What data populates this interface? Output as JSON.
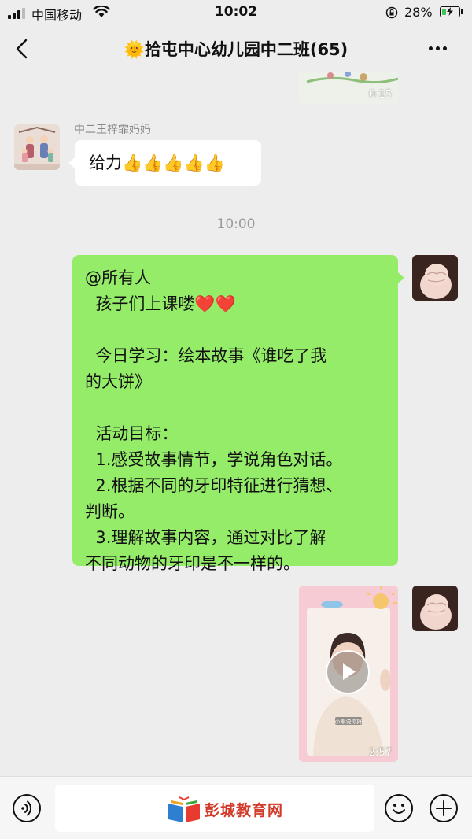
{
  "status_bar": {
    "carrier": "中国移动",
    "time": "10:02",
    "battery_percent": "28%",
    "battery_level": 0.28,
    "battery_color": "#43c15a"
  },
  "nav": {
    "title": "🌞拾屯中心幼儿园中二班(65)",
    "back_icon": "chevron-left-icon",
    "more_icon": "more-dots-icon"
  },
  "messages": {
    "top_video": {
      "duration": "0:15"
    },
    "msg1": {
      "sender": "中二王梓霏妈妈",
      "text": "给力👍👍👍👍👍"
    },
    "timestamp": "10:00",
    "msg2": {
      "lines": [
        "@所有人",
        "  孩子们上课喽❤️❤️",
        "",
        "  今日学习：绘本故事《谁吃了我",
        "的大饼》",
        "",
        "  活动目标：",
        "  1.感受故事情节，学说角色对话。",
        "  2.根据不同的牙印特征进行猜想、",
        "判断。",
        "  3.理解故事内容，通过对比了解",
        "不同动物的牙印是不一样的。"
      ]
    },
    "video2": {
      "duration": "2:57",
      "caption": "小熊说你好"
    }
  },
  "input_bar": {
    "voice_icon": "voice-icon",
    "emoji_icon": "emoji-icon",
    "plus_icon": "plus-icon",
    "watermark": "彭城教育网"
  },
  "colors": {
    "background": "#ededed",
    "bubble_right": "#95ec69",
    "bubble_left": "#ffffff"
  }
}
